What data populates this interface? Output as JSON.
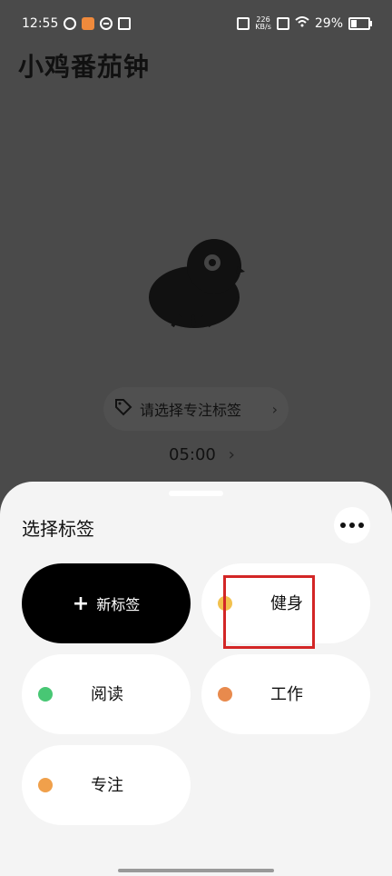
{
  "status_bar": {
    "time": "12:55",
    "net_speed_value": "226",
    "net_speed_unit": "KB/s",
    "battery": "29%"
  },
  "app": {
    "logo_text": "小鸡番茄钟",
    "select_tag_prompt": "请选择专注标签",
    "timer_value": "05:00"
  },
  "sheet": {
    "title": "选择标签",
    "new_tag_label": "新标签",
    "tags": [
      {
        "label": "健身",
        "color": "#f2c14e"
      },
      {
        "label": "阅读",
        "color": "#48c774"
      },
      {
        "label": "工作",
        "color": "#e88a4d"
      },
      {
        "label": "专注",
        "color": "#f0a04b"
      }
    ]
  },
  "colors": {
    "overlay": "#4a4a4a",
    "sheet_bg": "#f4f4f4",
    "highlight": "#d32626"
  }
}
